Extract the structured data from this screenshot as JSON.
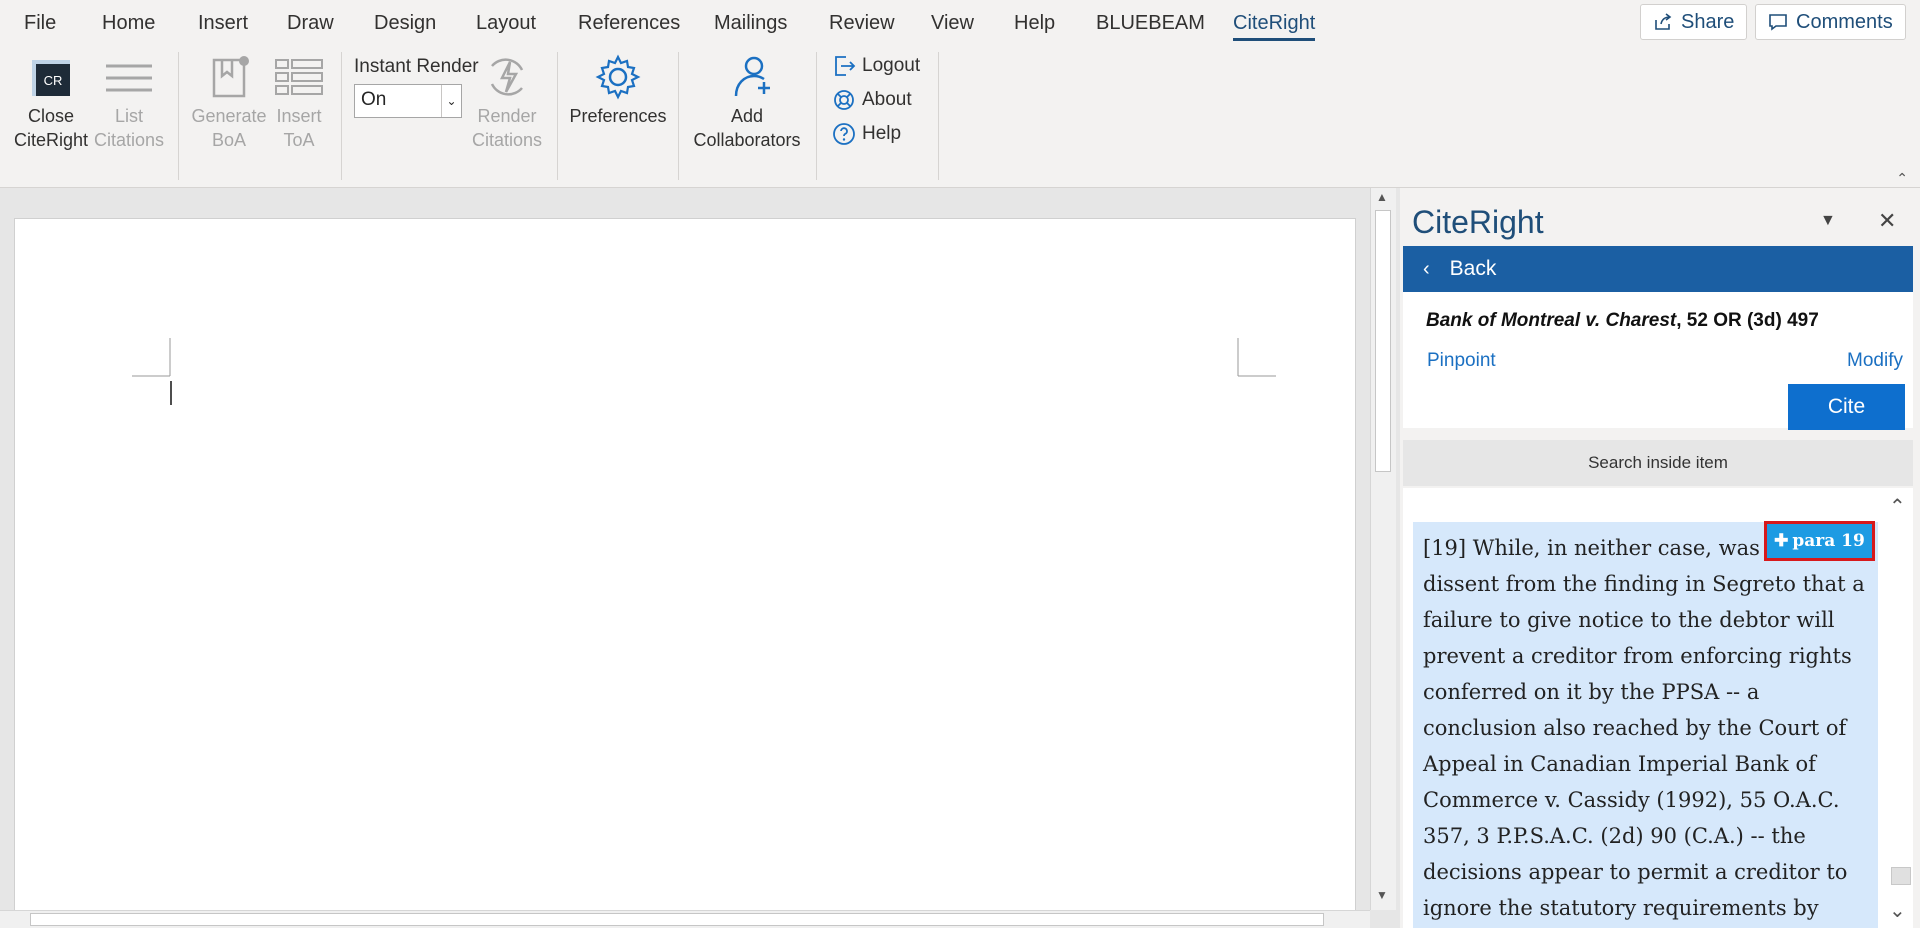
{
  "menu": {
    "tabs": [
      "File",
      "Home",
      "Insert",
      "Draw",
      "Design",
      "Layout",
      "References",
      "Mailings",
      "Review",
      "View",
      "Help",
      "BLUEBEAM",
      "CiteRight"
    ],
    "active_tab": "CiteRight",
    "share_label": "Share",
    "comments_label": "Comments"
  },
  "ribbon": {
    "close_citeright": "Close\nCiteRight",
    "list_citations": "List\nCitations",
    "generate_boa": "Generate\nBoA",
    "insert_toa": "Insert\nToA",
    "instant_render_label": "Instant Render",
    "instant_render_value": "On",
    "render_citations": "Render\nCitations",
    "preferences": "Preferences",
    "add_collaborators": "Add\nCollaborators",
    "logout": "Logout",
    "about": "About",
    "help": "Help",
    "logo_text": "CR"
  },
  "pane": {
    "title": "CiteRight",
    "back_label": "Back",
    "case_name": "Bank of Montreal v. Charest",
    "case_cite": ", 52 OR (3d) 497",
    "pinpoint_label": "Pinpoint",
    "modify_label": "Modify",
    "cite_label": "Cite",
    "search_label": "Search inside item",
    "para_button": "para 19",
    "paragraph_text": "[19] While, in neither case, was there a dissent from the finding in Segreto that a failure to give notice to the debtor will prevent a creditor from enforcing rights conferred on it by the PPSA -- a conclusion also reached by the Court of Appeal in Canadian Imperial Bank of Commerce v. Cassidy (1992), 55 O.A.C. 357, 3 P.P.S.A.C. (2d) 90 (C.A.) -- the decisions appear to permit a creditor to ignore the statutory requirements by"
  },
  "colors": {
    "brand_blue": "#1f4e79",
    "back_bar": "#1b5fa3",
    "cite_button": "#0e6fce",
    "para_highlight": "#d6e8fb",
    "para_button": "#1d9be3",
    "para_button_border": "#d7191c"
  }
}
